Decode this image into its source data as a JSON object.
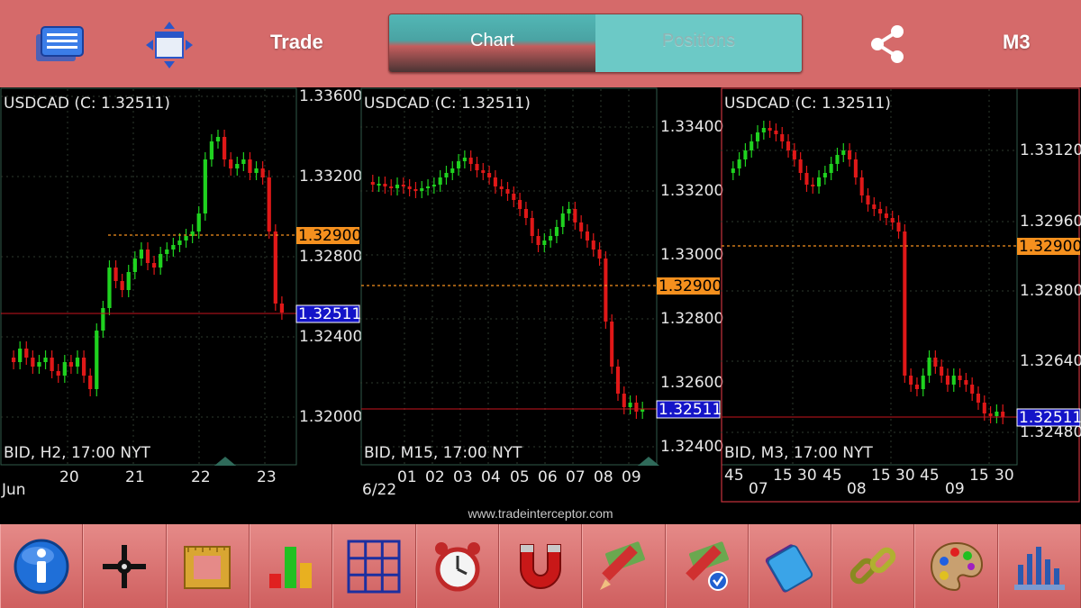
{
  "topbar": {
    "trade_label": "Trade",
    "tabs": [
      {
        "label": "Chart",
        "active": true
      },
      {
        "label": "Positions",
        "active": false
      }
    ],
    "timeframe_label": "M3",
    "icons": [
      "menu-icon",
      "move-arrows-icon",
      "share-icon"
    ]
  },
  "colors": {
    "bar_bg": "#d56a6a",
    "bull": "#1fd21f",
    "bear": "#e01818",
    "orange_line": "#f5901e",
    "current_price_bg": "#1414c8",
    "grid": "#2e3a2e"
  },
  "panels": [
    {
      "symbol": "USDCAD (C: 1.32511)",
      "footer": "BID, H2, 17:00 NYT",
      "axis_labels": [
        "1.33600",
        "1.33200",
        "1.32800",
        "1.32400",
        "1.32000"
      ],
      "orange_price": "1.32900",
      "current_price": "1.32511",
      "x_labels": [
        "20",
        "21",
        "22",
        "23"
      ],
      "x_sub_label": "Jun"
    },
    {
      "symbol": "USDCAD (C: 1.32511)",
      "footer": "BID, M15, 17:00 NYT",
      "axis_labels": [
        "1.33400",
        "1.33200",
        "1.33000",
        "1.32800",
        "1.32600",
        "1.32400"
      ],
      "orange_price": "1.32900",
      "current_price": "1.32511",
      "x_labels": [
        "01",
        "02",
        "03",
        "04",
        "05",
        "06",
        "07",
        "08",
        "09"
      ],
      "x_sub_label": "6/22"
    },
    {
      "symbol": "USDCAD (C: 1.32511)",
      "footer": "BID, M3, 17:00 NYT",
      "axis_labels": [
        "1.33120",
        "1.32960",
        "1.32800",
        "1.32640",
        "1.32480"
      ],
      "orange_price": "1.32900",
      "current_price": "1.32511",
      "x_labels": [
        "45",
        "15",
        "30",
        "45",
        "15",
        "30",
        "45",
        "15",
        "30"
      ],
      "x_sub_labels": [
        "07",
        "08",
        "09"
      ]
    }
  ],
  "watermark": "www.tradeinterceptor.com",
  "toolbar": {
    "tools": [
      "info-icon",
      "crosshair-icon",
      "ruler-frame-icon",
      "indicators-bars-icon",
      "grid-icon",
      "alarm-clock-icon",
      "magnet-icon",
      "trade-tool-icon",
      "trade-tool-v-icon",
      "clipboard-icon",
      "link-chain-icon",
      "palette-icon",
      "chart-settings-icon"
    ]
  }
}
